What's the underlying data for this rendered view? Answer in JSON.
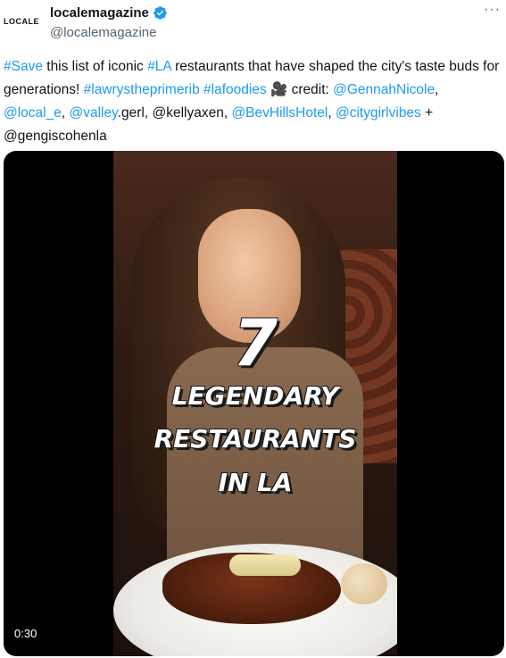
{
  "account": {
    "avatar_text": "LOCALE",
    "display_name": "localemagazine",
    "handle": "@localemagazine"
  },
  "more_label": "···",
  "tweet": {
    "seg1": "#Save",
    "seg2": " this list of iconic ",
    "seg3": "#LA",
    "seg4": " restaurants that have shaped the city's taste buds for generations! ",
    "seg5": "#lawrystheprimerib",
    "seg6": " ",
    "seg7": "#lafoodies",
    "seg8": " 🎥 credit: ",
    "seg9": "@GennahNicole",
    "seg10": ", ",
    "seg11": "@local_e",
    "seg12": ", ",
    "seg13": "@valley",
    "seg14": ".gerl, @kellyaxen, ",
    "seg15": "@BevHillsHotel",
    "seg16": ", ",
    "seg17": "@citygirlvibes",
    "seg18": " + @gengiscohenla"
  },
  "video": {
    "overlay_number": "7",
    "overlay_line1": "LEGENDARY",
    "overlay_line2": "RESTAURANTS",
    "overlay_line3": "IN LA",
    "time": "0:30"
  },
  "colors": {
    "link": "#1d9bf0",
    "verified": "#1d9bf0",
    "secondary_text": "#536471"
  }
}
